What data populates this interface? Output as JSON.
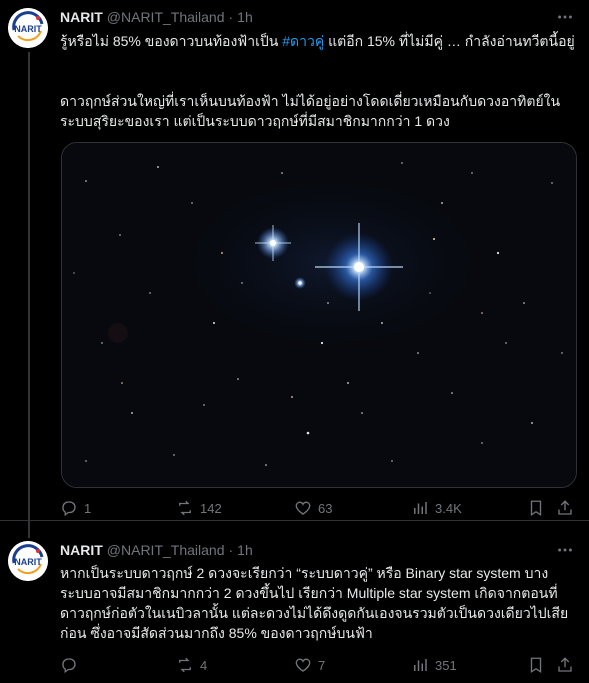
{
  "tweets": [
    {
      "author_name": "NARIT",
      "handle": "@NARIT_Thailand",
      "separator": "·",
      "time": "1h",
      "text_part1_before": "รู้หรือไม่ 85% ของดาวบนท้องฟ้าเป็น ",
      "hashtag": "#ดาวคู่",
      "text_part1_after": " แต่อีก 15% ที่ไม่มีคู่ … กำลังอ่านทวีตนี้อยู่",
      "text_part2": "ดาวฤกษ์ส่วนใหญ่ที่เราเห็นบนท้องฟ้า ไม่ได้อยู่อย่างโดดเดี่ยวเหมือนกับดวงอาทิตย์ในระบบสุริยะของเรา แต่เป็นระบบดาวฤกษ์ที่มีสมาชิกมากกว่า 1 ดวง",
      "replies": "1",
      "reposts": "142",
      "likes": "63",
      "views": "3.4K"
    },
    {
      "author_name": "NARIT",
      "handle": "@NARIT_Thailand",
      "separator": "·",
      "time": "1h",
      "text": "หากเป็นระบบดาวฤกษ์ 2 ดวงจะเรียกว่า “ระบบดาวคู่” หรือ Binary star system บางระบบอาจมีสมาชิกมากกว่า 2 ดวงขึ้นไป เรียกว่า Multiple star system เกิดจากตอนที่ดาวฤกษ์ก่อตัวในเนบิวลานั้น แต่ละดวงไม่ได้ดึงดูดกันเองจนรวมตัวเป็นดวงเดียวไปเสียก่อน ซึ่งอาจมีสัดส่วนมากถึง 85% ของดาวฤกษ์บนฟ้า",
      "replies": "",
      "reposts": "4",
      "likes": "7",
      "views": "351"
    }
  ],
  "avatar_logo_text": "NARIT",
  "colors": {
    "background": "#000000",
    "text": "#e7e9ea",
    "muted": "#71767b",
    "link": "#1d9bf0",
    "divider": "#2f3336"
  },
  "icons": [
    "narit-logo",
    "more-icon",
    "reply-icon",
    "repost-icon",
    "like-icon",
    "views-icon",
    "bookmark-icon",
    "share-icon"
  ]
}
